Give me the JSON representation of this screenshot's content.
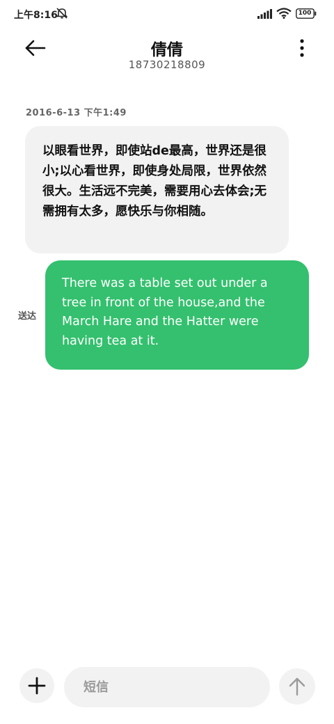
{
  "status_bar": {
    "time": "上午8:16",
    "battery_level": "100",
    "icons": [
      "mute-icon",
      "signal-icon",
      "wifi-icon",
      "battery-icon"
    ]
  },
  "header": {
    "contact_name": "倩倩",
    "contact_number": "18730218809",
    "back_icon": "arrow-left-icon",
    "more_icon": "more-vertical-icon"
  },
  "conversation": {
    "timestamp": "2016-6-13 下午1:49",
    "messages": [
      {
        "direction": "incoming",
        "text": "以眼看世界，即使站de最高，世界还是很小;以心看世界，即使身处局限，世界依然很大。生活远不完美，需要用心去体会;无需拥有太多，愿快乐与你相随。"
      },
      {
        "direction": "outgoing",
        "status": "送达",
        "text": "There was a table set out under a tree in front of the house,and the March Hare and the Hatter were having tea at it."
      }
    ]
  },
  "composer": {
    "placeholder": "短信",
    "add_icon": "plus-icon",
    "send_icon": "arrow-up-icon"
  },
  "colors": {
    "outgoing_bubble": "#34c06e",
    "incoming_bubble": "#f2f2f2",
    "background": "#ffffff"
  }
}
